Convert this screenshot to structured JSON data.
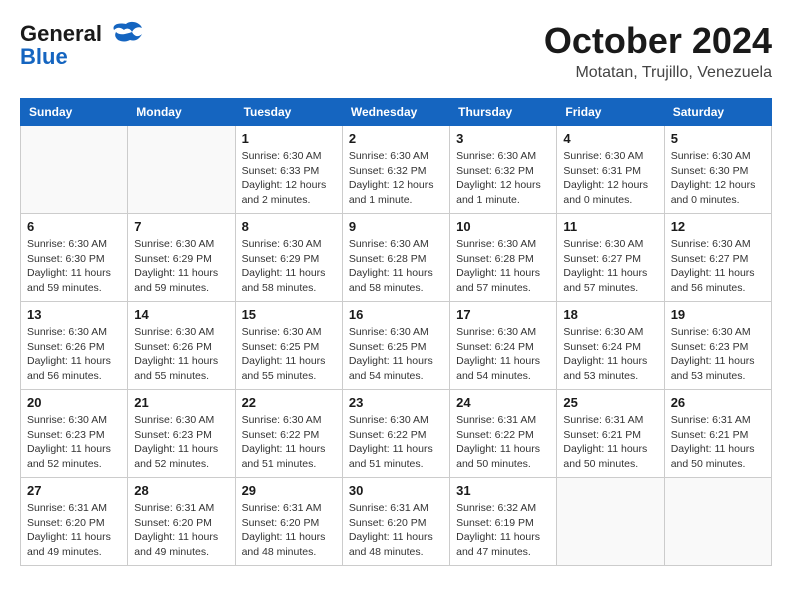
{
  "header": {
    "logo_line1": "General",
    "logo_line2": "Blue",
    "month_title": "October 2024",
    "location": "Motatan, Trujillo, Venezuela"
  },
  "weekdays": [
    "Sunday",
    "Monday",
    "Tuesday",
    "Wednesday",
    "Thursday",
    "Friday",
    "Saturday"
  ],
  "weeks": [
    [
      {
        "day": "",
        "info": ""
      },
      {
        "day": "",
        "info": ""
      },
      {
        "day": "1",
        "info": "Sunrise: 6:30 AM\nSunset: 6:33 PM\nDaylight: 12 hours\nand 2 minutes."
      },
      {
        "day": "2",
        "info": "Sunrise: 6:30 AM\nSunset: 6:32 PM\nDaylight: 12 hours\nand 1 minute."
      },
      {
        "day": "3",
        "info": "Sunrise: 6:30 AM\nSunset: 6:32 PM\nDaylight: 12 hours\nand 1 minute."
      },
      {
        "day": "4",
        "info": "Sunrise: 6:30 AM\nSunset: 6:31 PM\nDaylight: 12 hours\nand 0 minutes."
      },
      {
        "day": "5",
        "info": "Sunrise: 6:30 AM\nSunset: 6:30 PM\nDaylight: 12 hours\nand 0 minutes."
      }
    ],
    [
      {
        "day": "6",
        "info": "Sunrise: 6:30 AM\nSunset: 6:30 PM\nDaylight: 11 hours\nand 59 minutes."
      },
      {
        "day": "7",
        "info": "Sunrise: 6:30 AM\nSunset: 6:29 PM\nDaylight: 11 hours\nand 59 minutes."
      },
      {
        "day": "8",
        "info": "Sunrise: 6:30 AM\nSunset: 6:29 PM\nDaylight: 11 hours\nand 58 minutes."
      },
      {
        "day": "9",
        "info": "Sunrise: 6:30 AM\nSunset: 6:28 PM\nDaylight: 11 hours\nand 58 minutes."
      },
      {
        "day": "10",
        "info": "Sunrise: 6:30 AM\nSunset: 6:28 PM\nDaylight: 11 hours\nand 57 minutes."
      },
      {
        "day": "11",
        "info": "Sunrise: 6:30 AM\nSunset: 6:27 PM\nDaylight: 11 hours\nand 57 minutes."
      },
      {
        "day": "12",
        "info": "Sunrise: 6:30 AM\nSunset: 6:27 PM\nDaylight: 11 hours\nand 56 minutes."
      }
    ],
    [
      {
        "day": "13",
        "info": "Sunrise: 6:30 AM\nSunset: 6:26 PM\nDaylight: 11 hours\nand 56 minutes."
      },
      {
        "day": "14",
        "info": "Sunrise: 6:30 AM\nSunset: 6:26 PM\nDaylight: 11 hours\nand 55 minutes."
      },
      {
        "day": "15",
        "info": "Sunrise: 6:30 AM\nSunset: 6:25 PM\nDaylight: 11 hours\nand 55 minutes."
      },
      {
        "day": "16",
        "info": "Sunrise: 6:30 AM\nSunset: 6:25 PM\nDaylight: 11 hours\nand 54 minutes."
      },
      {
        "day": "17",
        "info": "Sunrise: 6:30 AM\nSunset: 6:24 PM\nDaylight: 11 hours\nand 54 minutes."
      },
      {
        "day": "18",
        "info": "Sunrise: 6:30 AM\nSunset: 6:24 PM\nDaylight: 11 hours\nand 53 minutes."
      },
      {
        "day": "19",
        "info": "Sunrise: 6:30 AM\nSunset: 6:23 PM\nDaylight: 11 hours\nand 53 minutes."
      }
    ],
    [
      {
        "day": "20",
        "info": "Sunrise: 6:30 AM\nSunset: 6:23 PM\nDaylight: 11 hours\nand 52 minutes."
      },
      {
        "day": "21",
        "info": "Sunrise: 6:30 AM\nSunset: 6:23 PM\nDaylight: 11 hours\nand 52 minutes."
      },
      {
        "day": "22",
        "info": "Sunrise: 6:30 AM\nSunset: 6:22 PM\nDaylight: 11 hours\nand 51 minutes."
      },
      {
        "day": "23",
        "info": "Sunrise: 6:30 AM\nSunset: 6:22 PM\nDaylight: 11 hours\nand 51 minutes."
      },
      {
        "day": "24",
        "info": "Sunrise: 6:31 AM\nSunset: 6:22 PM\nDaylight: 11 hours\nand 50 minutes."
      },
      {
        "day": "25",
        "info": "Sunrise: 6:31 AM\nSunset: 6:21 PM\nDaylight: 11 hours\nand 50 minutes."
      },
      {
        "day": "26",
        "info": "Sunrise: 6:31 AM\nSunset: 6:21 PM\nDaylight: 11 hours\nand 50 minutes."
      }
    ],
    [
      {
        "day": "27",
        "info": "Sunrise: 6:31 AM\nSunset: 6:20 PM\nDaylight: 11 hours\nand 49 minutes."
      },
      {
        "day": "28",
        "info": "Sunrise: 6:31 AM\nSunset: 6:20 PM\nDaylight: 11 hours\nand 49 minutes."
      },
      {
        "day": "29",
        "info": "Sunrise: 6:31 AM\nSunset: 6:20 PM\nDaylight: 11 hours\nand 48 minutes."
      },
      {
        "day": "30",
        "info": "Sunrise: 6:31 AM\nSunset: 6:20 PM\nDaylight: 11 hours\nand 48 minutes."
      },
      {
        "day": "31",
        "info": "Sunrise: 6:32 AM\nSunset: 6:19 PM\nDaylight: 11 hours\nand 47 minutes."
      },
      {
        "day": "",
        "info": ""
      },
      {
        "day": "",
        "info": ""
      }
    ]
  ]
}
